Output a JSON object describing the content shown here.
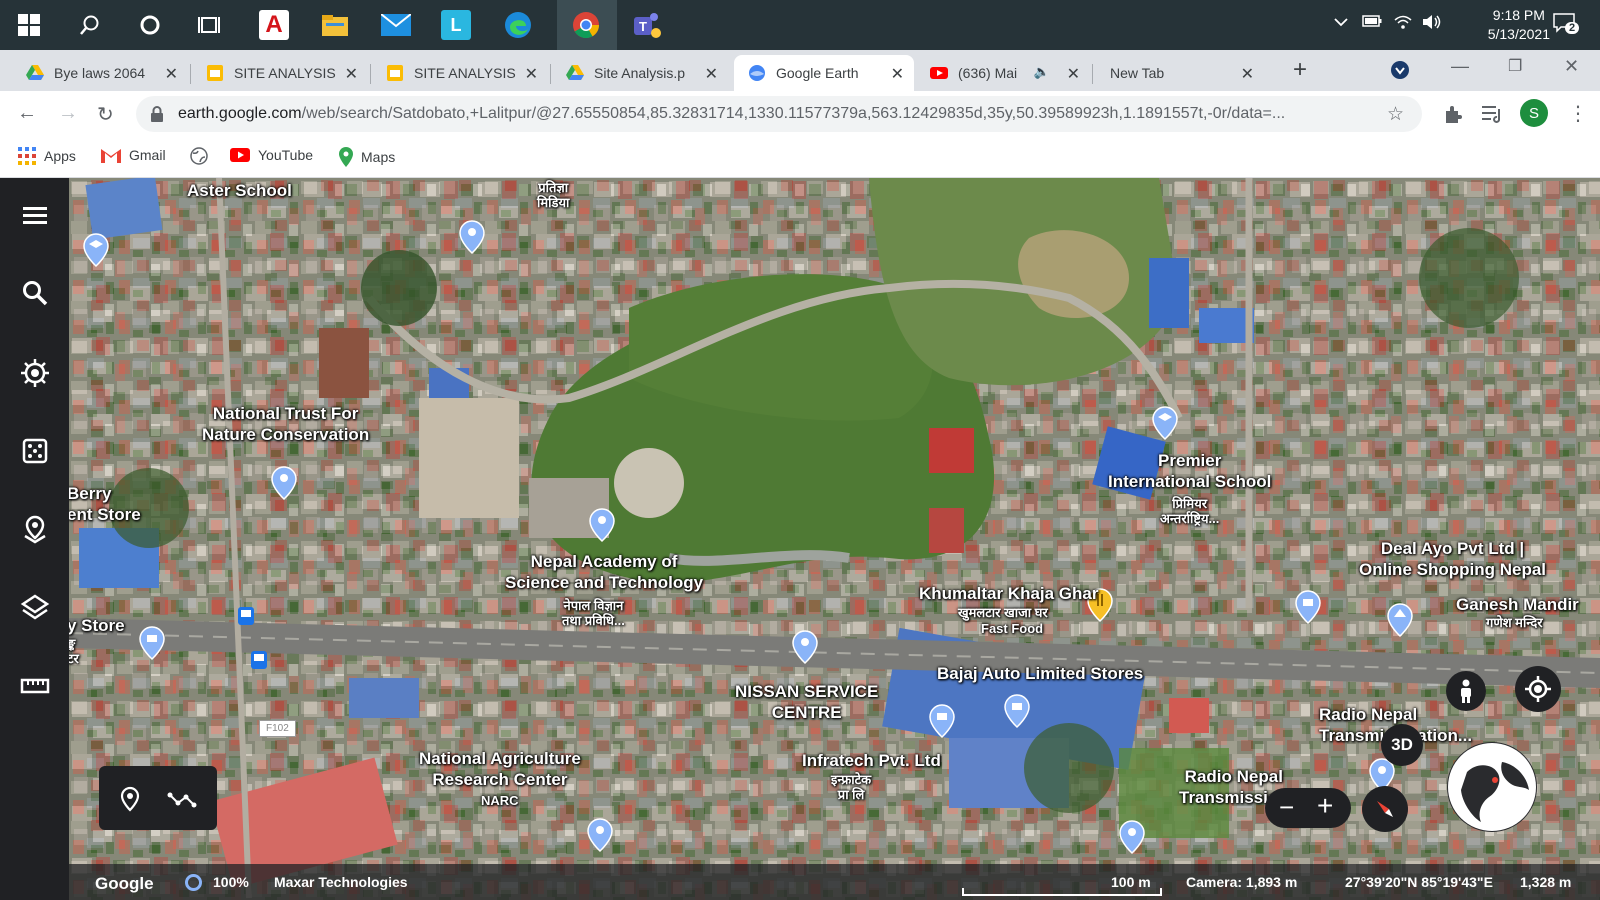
{
  "taskbar": {
    "time": "9:18 PM",
    "date": "5/13/2021",
    "notification_count": "2",
    "colors": {
      "bg": "#263338"
    },
    "icons": [
      "windows-start-icon",
      "search-icon",
      "cortana-icon",
      "task-view-icon",
      "acrobat-icon",
      "file-explorer-icon",
      "mail-icon",
      "lens-icon",
      "edge-icon",
      "chrome-icon",
      "teams-icon"
    ]
  },
  "tabs": [
    {
      "label": "Bye laws 2064",
      "icon": "drive-icon"
    },
    {
      "label": "SITE ANALYSIS",
      "icon": "slides-icon"
    },
    {
      "label": "SITE ANALYSIS",
      "icon": "slides-icon"
    },
    {
      "label": "Site Analysis.p",
      "icon": "drive-icon"
    },
    {
      "label": "Google Earth",
      "icon": "earth-icon",
      "active": true
    },
    {
      "label": "(636) Mai",
      "icon": "youtube-icon"
    },
    {
      "label": "New Tab",
      "icon": ""
    }
  ],
  "address": {
    "host": "earth.google.com",
    "path": "/web/search/Satdobato,+Lalitpur/@27.65550854,85.32831714,1330.11577379a,563.12429835d,35y,50.39589923h,1.1891557t,-0r/data=...",
    "profile_initial": "S"
  },
  "bookmarks": [
    {
      "label": "Apps",
      "icon": "apps-grid-icon"
    },
    {
      "label": "Gmail",
      "icon": "gmail-icon"
    },
    {
      "label": "",
      "icon": "globe-icon"
    },
    {
      "label": "YouTube",
      "icon": "youtube-icon"
    },
    {
      "label": "Maps",
      "icon": "maps-icon"
    }
  ],
  "map_labels": {
    "aster": "Aster School",
    "pratiksha": "प्रतिज्ञा\nमिडिया",
    "ntnc": "National Trust For\nNature Conservation",
    "berry": "Berry\nent Store",
    "nast": "Nepal Academy of\nScience and Technology",
    "nast_np": "नेपाल विज्ञान\nतथा प्रविधि...",
    "premier": "Premier\nInternational School",
    "premier_np": "प्रिमियर\nअन्तर्राष्ट्रिय...",
    "deal": "Deal Ayo Pvt Ltd |\nOnline Shopping Nepal",
    "khumaltar": "Khumaltar Khaja Ghar",
    "khumaltar_np": "खुमलटार खाजा घर",
    "fastfood": "Fast Food",
    "ganesh": "Ganesh Mandir",
    "ganesh_np": "गणेश मन्दिर",
    "ystore": "y Store",
    "ystore_np": "ङ्क\nटर",
    "bajaj": "Bajaj Auto Limited Stores",
    "nissan": "NISSAN SERVICE\nCENTRE",
    "narc": "National Agriculture\nResearch Center",
    "narc_abbr": "NARC",
    "infratech": "Infratech Pvt. Ltd",
    "infratech_np": "इन्फ्राटेक\nप्रा लि",
    "radio1": "Radio Nepal\nTransmiss   ation...",
    "radio2": "Radio Nepal\nTransmission",
    "road": "F102"
  },
  "controls": {
    "threeD": "3D",
    "zoom_minus": "−",
    "zoom_plus": "+"
  },
  "status": {
    "brand": "Google",
    "progress": "100%",
    "attribution": "Maxar Technologies",
    "scale": "100 m",
    "camera": "Camera: 1,893 m",
    "coords": "27°39'20\"N 85°19'43\"E",
    "elevation": "1,328 m"
  }
}
